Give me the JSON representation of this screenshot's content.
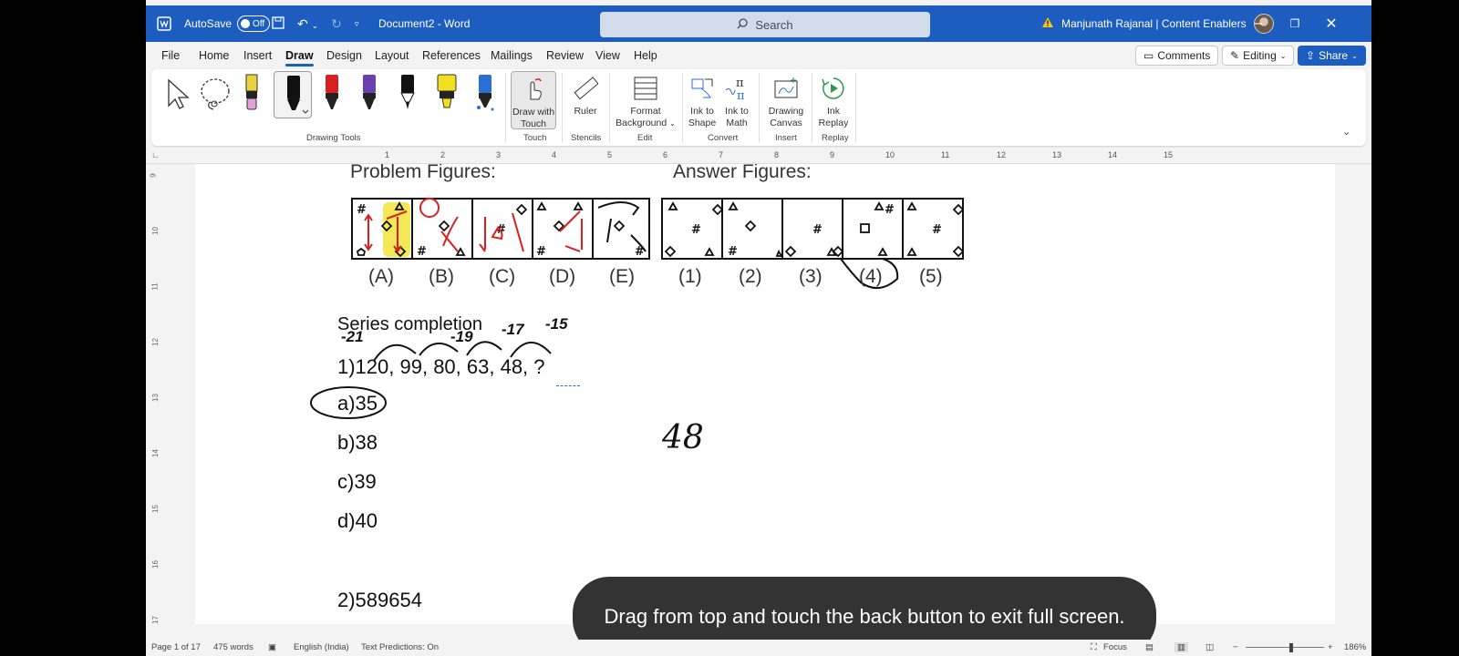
{
  "titlebar": {
    "autosave_label": "AutoSave",
    "autosave_state": "Off",
    "doc_title": "Document2 - Word",
    "search_placeholder": "Search",
    "user": "Manjunath Rajanal | Content Enablers"
  },
  "menu": {
    "tabs": [
      "File",
      "Home",
      "Insert",
      "Draw",
      "Design",
      "Layout",
      "References",
      "Mailings",
      "Review",
      "View",
      "Help"
    ],
    "active_tab": "Draw",
    "comments": "Comments",
    "editing": "Editing",
    "share": "Share"
  },
  "ribbon": {
    "groups": {
      "drawing_tools": "Drawing Tools",
      "touch": "Touch",
      "stencils": "Stencils",
      "edit": "Edit",
      "convert": "Convert",
      "insert": "Insert",
      "replay": "Replay"
    },
    "buttons": {
      "draw_with_touch": [
        "Draw with",
        "Touch"
      ],
      "ruler": "Ruler",
      "format_background": [
        "Format",
        "Background"
      ],
      "ink_to_shape": [
        "Ink to",
        "Shape"
      ],
      "ink_to_math": [
        "Ink to",
        "Math"
      ],
      "drawing_canvas": [
        "Drawing",
        "Canvas"
      ],
      "ink_replay": [
        "Ink",
        "Replay"
      ]
    },
    "pen_colors": [
      "#e8d33a",
      "#111111",
      "#d92020",
      "#6a3fb0",
      "#111111",
      "#f2e020",
      "#2a6fd6"
    ]
  },
  "rulers": {
    "horizontal": [
      "1",
      "2",
      "3",
      "4",
      "5",
      "6",
      "7",
      "8",
      "9",
      "10",
      "11",
      "12",
      "13",
      "14",
      "15"
    ],
    "vertical": [
      "9",
      "10",
      "11",
      "12",
      "13",
      "14",
      "15",
      "16",
      "17"
    ]
  },
  "document": {
    "problem_heading": "Problem Figures:",
    "answer_heading": "Answer Figures:",
    "problem_labels": [
      "(A)",
      "(B)",
      "(C)",
      "(D)",
      "(E)"
    ],
    "answer_labels": [
      "(1)",
      "(2)",
      "(3)",
      "(4)",
      "(5)"
    ],
    "section_title": "Series completion",
    "question1": "1)120, 99, 80, 63, 48, ?",
    "options": [
      "a)35",
      "b)38",
      "c)39",
      "d)40"
    ],
    "question2": "2)589654",
    "ink_annotations": [
      "-21",
      "-19",
      "-17",
      "-15",
      "48"
    ]
  },
  "toast": {
    "message": "Drag from top and touch the back button to exit full screen."
  },
  "statusbar": {
    "page": "Page 1 of 17",
    "words": "475 words",
    "language": "English (India)",
    "predictions": "Text Predictions: On",
    "focus": "Focus",
    "zoom": "186%"
  }
}
